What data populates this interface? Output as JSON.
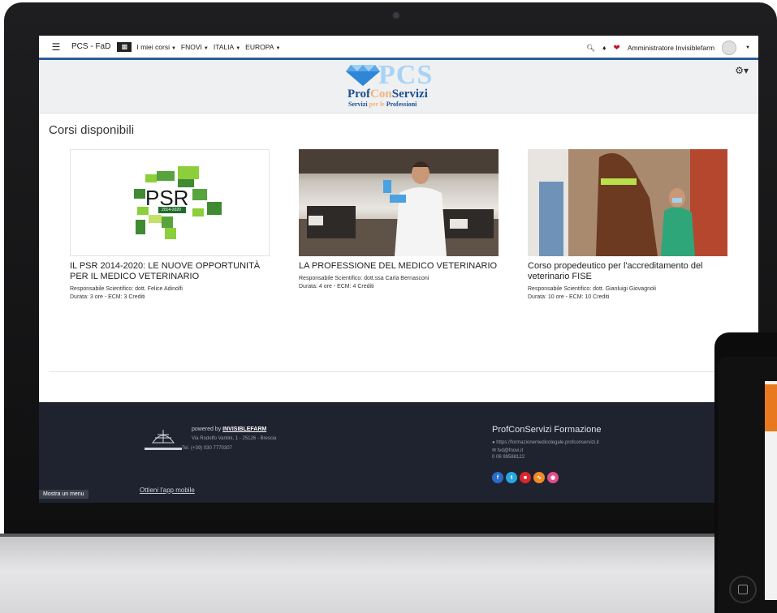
{
  "navbar": {
    "brand": "PCS - FaD",
    "menus": [
      {
        "label": "I miei corsi"
      },
      {
        "label": "FNOVI"
      },
      {
        "label": "ITALIA"
      },
      {
        "label": "EUROPA"
      }
    ],
    "user_name": "Amministratore Invisiblefarm"
  },
  "logo": {
    "pcs": "PCS",
    "name_a": "Prof",
    "name_b": "Con",
    "name_c": "Servizi",
    "sub_a": "Servizi",
    "sub_b": "per le",
    "sub_c": "Professioni"
  },
  "main": {
    "section_title": "Corsi disponibili",
    "courses": [
      {
        "title": "IL PSR 2014-2020: LE NUOVE OPPORTUNITÀ PER IL MEDICO VETERINARIO",
        "resp": "Responsabile Scientifico: dott. Felice Adinolfi",
        "duration": "Durata: 3 ore - ECM: 3 Crediti",
        "image_text": "PSR",
        "image_sub": "2014-2020"
      },
      {
        "title": "LA PROFESSIONE DEL MEDICO VETERINARIO",
        "resp": "Responsabile Scientifico: dott.ssa Carla Bernasconi",
        "duration": "Durata: 4 ore - ECM: 4 Crediti"
      },
      {
        "title": "Corso propedeutico per l'accreditamento del veterinario FISE",
        "resp": "Responsabile Scientifico: dott. Gianluigi Giovagnoli",
        "duration": "Durata: 10 ore - ECM: 10 Crediti"
      }
    ]
  },
  "footer": {
    "powered_prefix": "powered by",
    "powered_brand": "INVISIBLEFARM",
    "address": "Via Rodolfo Vantini, 1 - 25126 - Brescia",
    "tel": "Tel. (+39) 030 7770307",
    "app_link": "Ottieni l'app mobile",
    "show_menu": "Mostra un menu",
    "org_title": "ProfConServizi Formazione",
    "web": "https://formazionemedicolegale.profconservizi.it",
    "mail": "fvd@fnovi.it",
    "phone": "0 06 99588122"
  },
  "colors": {
    "nav_accent": "#2a5d9f",
    "footer_bg": "#1f2330",
    "social": [
      "#2a6ac9",
      "#28a6e0",
      "#d9262b",
      "#f08a24",
      "#e04d8b"
    ]
  }
}
